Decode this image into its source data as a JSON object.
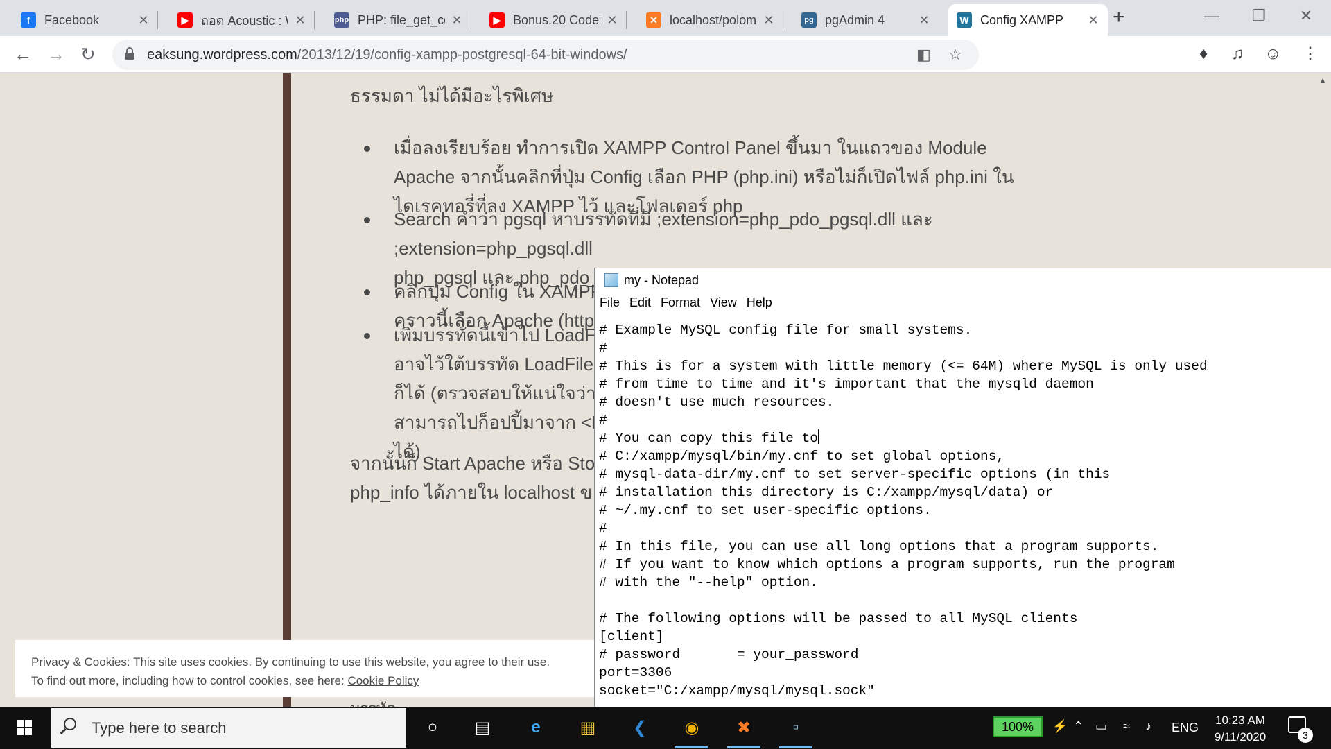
{
  "browser": {
    "tabs": [
      {
        "title": "Facebook",
        "icon": "facebook-icon",
        "color": "#1877f2",
        "glyph": "f"
      },
      {
        "title": "ถอด Acoustic : W",
        "icon": "youtube-icon",
        "color": "#ff0000",
        "glyph": "▶"
      },
      {
        "title": "PHP: file_get_co",
        "icon": "php-icon",
        "color": "#4f5b93",
        "glyph": "php"
      },
      {
        "title": "Bonus.20 Codeig",
        "icon": "youtube-icon",
        "color": "#ff0000",
        "glyph": "▶"
      },
      {
        "title": "localhost/polom",
        "icon": "xampp-icon",
        "color": "#fb7a24",
        "glyph": "✕"
      },
      {
        "title": "pgAdmin 4",
        "icon": "pgadmin-icon",
        "color": "#336791",
        "glyph": "pg"
      },
      {
        "title": "Config XAMPP",
        "icon": "wordpress-icon",
        "color": "#21759b",
        "glyph": "W"
      }
    ],
    "new_tab": "+",
    "url_host": "eaksung.wordpress.com",
    "url_path": "/2013/12/19/config-xampp-postgresql-64-bit-windows/"
  },
  "article": {
    "para_top": "ธรรมดา ไม่ได้มีอะไรพิเศษ",
    "bullets": [
      [
        "เมื่อลงเรียบร้อย ทำการเปิด XAMPP Control Panel ขึ้นมา ในแถวของ Module",
        "Apache จากนั้นคลิกที่ปุ่ม Config เลือก PHP (php.ini) หรือไม่ก็เปิดไฟล์ php.ini ใน",
        "ไดเรคทอรี่ที่ลง XAMPP ไว้ และโฟลเดอร์ php"
      ],
      [
        "Search คำว่า pgsql หาบรรทัดที่มี ;extension=php_pdo_pgsql.dll และ",
        ";extension=php_pgsql.dll",
        "php_pgsql และ php_pdo_"
      ],
      [
        "คลิกปุ่ม Config ใน XAMPP",
        "คราวนี้เลือก Apache (httpd-"
      ],
      [
        "เพิ่มบรรทัดนี้เข้าไป LoadFile",
        "อาจไว้ใต้บรรทัด LoadFile \"",
        "ก็ได้ (ตรวจสอบให้แน่ใจว่าไฟ",
        "สามารถไปก็อปปี้มาจาก <PC",
        "ได้)"
      ]
    ],
    "para_bottom": [
      "จากนั้นก็ Start Apache หรือ Sto",
      "php_info ได้ภายใน localhost ข"
    ],
    "peek": "บรรทัด"
  },
  "cookie": {
    "line1": "Privacy & Cookies: This site uses cookies. By continuing to use this website, you agree to their use.",
    "line2": "To find out more, including how to control cookies, see here:",
    "link": "Cookie Policy"
  },
  "notepad": {
    "title": "my - Notepad",
    "menu": [
      "File",
      "Edit",
      "Format",
      "View",
      "Help"
    ],
    "lines": [
      "# Example MySQL config file for small systems.",
      "#",
      "# This is for a system with little memory (<= 64M) where MySQL is only used",
      "# from time to time and it's important that the mysqld daemon",
      "# doesn't use much resources.",
      "#",
      "# You can copy this file to",
      "# C:/xampp/mysql/bin/my.cnf to set global options,",
      "# mysql-data-dir/my.cnf to set server-specific options (in this",
      "# installation this directory is C:/xampp/mysql/data) or",
      "# ~/.my.cnf to set user-specific options.",
      "#",
      "# In this file, you can use all long options that a program supports.",
      "# If you want to know which options a program supports, run the program",
      "# with the \"--help\" option.",
      "",
      "# The following options will be passed to all MySQL clients",
      "[client]",
      "# password       = your_password",
      "port=3306",
      "socket=\"C:/xampp/mysql/mysql.sock\""
    ],
    "caret_line": 6
  },
  "taskbar": {
    "search_placeholder": "Type here to search",
    "battery": "100%",
    "language": "ENG",
    "time": "10:23 AM",
    "date": "9/11/2020",
    "notifications": "3"
  }
}
